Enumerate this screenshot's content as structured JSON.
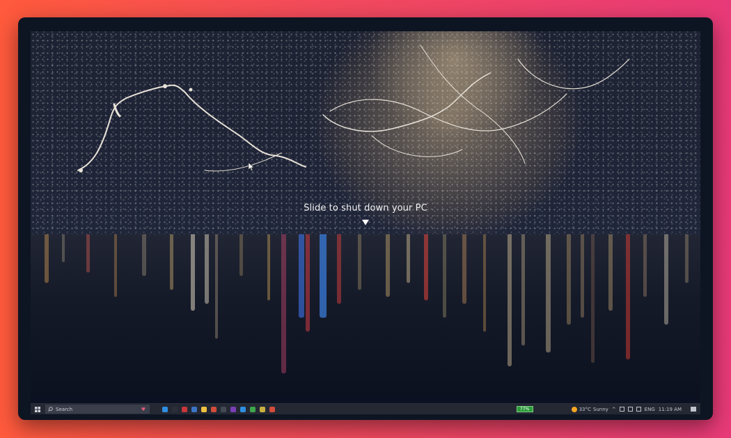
{
  "shutdown": {
    "prompt": "Slide to shut down your PC"
  },
  "taskbar": {
    "search_placeholder": "Search",
    "battery": "77%",
    "weather_temp": "33°C",
    "weather_condition": "Sunny",
    "language": "ENG",
    "time": "11:19 AM",
    "pinned_icons": [
      "edge-icon",
      "photos-icon",
      "word-icon",
      "store-icon",
      "explorer-icon",
      "notes-icon",
      "terminal-icon",
      "onenote-icon",
      "vscode-icon",
      "chrome-icon",
      "mail-icon",
      "files-icon"
    ],
    "pinned_colors": [
      "#2f8ee0",
      "#2a2f3a",
      "#c9373b",
      "#3b74c4",
      "#f0c040",
      "#d24c3b",
      "#444a55",
      "#7a3fb6",
      "#2f8ee0",
      "#3da64b",
      "#c8b040",
      "#d24c3b"
    ]
  }
}
